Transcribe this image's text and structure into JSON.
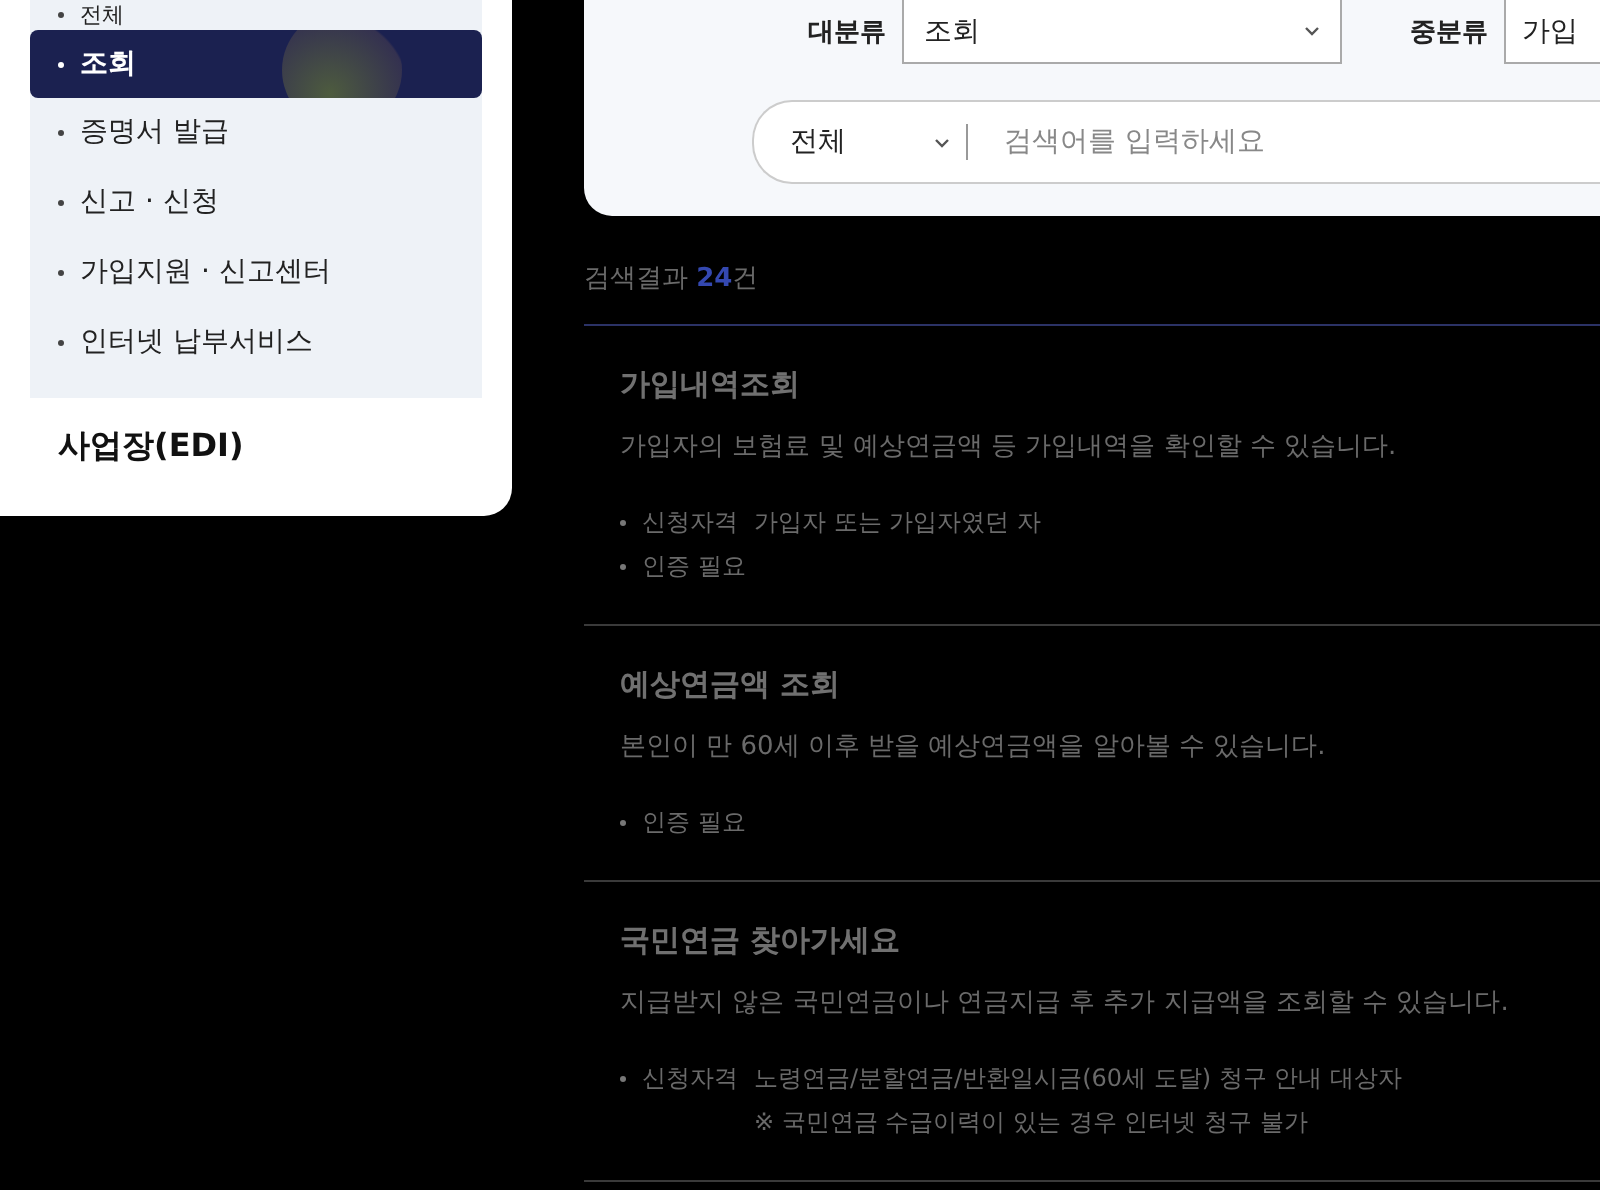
{
  "sidebar": {
    "items": [
      {
        "label": "전체",
        "selected": false
      },
      {
        "label": "조회",
        "selected": true
      },
      {
        "label": "증명서 발급",
        "selected": false
      },
      {
        "label": "신고 · 신청",
        "selected": false
      },
      {
        "label": "가입지원 · 신고센터",
        "selected": false
      },
      {
        "label": "인터넷 납부서비스",
        "selected": false
      }
    ],
    "section": "사업장(EDI)"
  },
  "filters": {
    "major": {
      "label": "대분류",
      "value": "조회"
    },
    "middle": {
      "label": "중분류",
      "value": "가입"
    },
    "search": {
      "scope": "전체",
      "placeholder": "검색어를 입력하세요"
    }
  },
  "results": {
    "prefix": "검색결과 ",
    "count": "24",
    "suffix": "건",
    "items": [
      {
        "title": "가입내역조회",
        "description": "가입자의 보험료 및 예상연금액 등 가입내역을 확인할 수 있습니다.",
        "details": [
          {
            "label": "신청자격",
            "lines": [
              "가입자 또는 가입자였던 자"
            ]
          },
          {
            "label": "인증 필요"
          }
        ]
      },
      {
        "title": "예상연금액 조회",
        "description": "본인이 만 60세 이후 받을 예상연금액을 알아볼 수 있습니다.",
        "details": [
          {
            "label": "인증 필요"
          }
        ]
      },
      {
        "title": "국민연금 찾아가세요",
        "description": "지급받지 않은 국민연금이나 연금지급 후 추가 지급액을 조회할 수 있습니다.",
        "details": [
          {
            "label": "신청자격",
            "lines": [
              "노령연금/분할연금/반환일시금(60세 도달) 청구 안내 대상자",
              "※ 국민연금 수급이력이 있는 경우 인터넷 청구 불가"
            ]
          }
        ]
      }
    ]
  }
}
